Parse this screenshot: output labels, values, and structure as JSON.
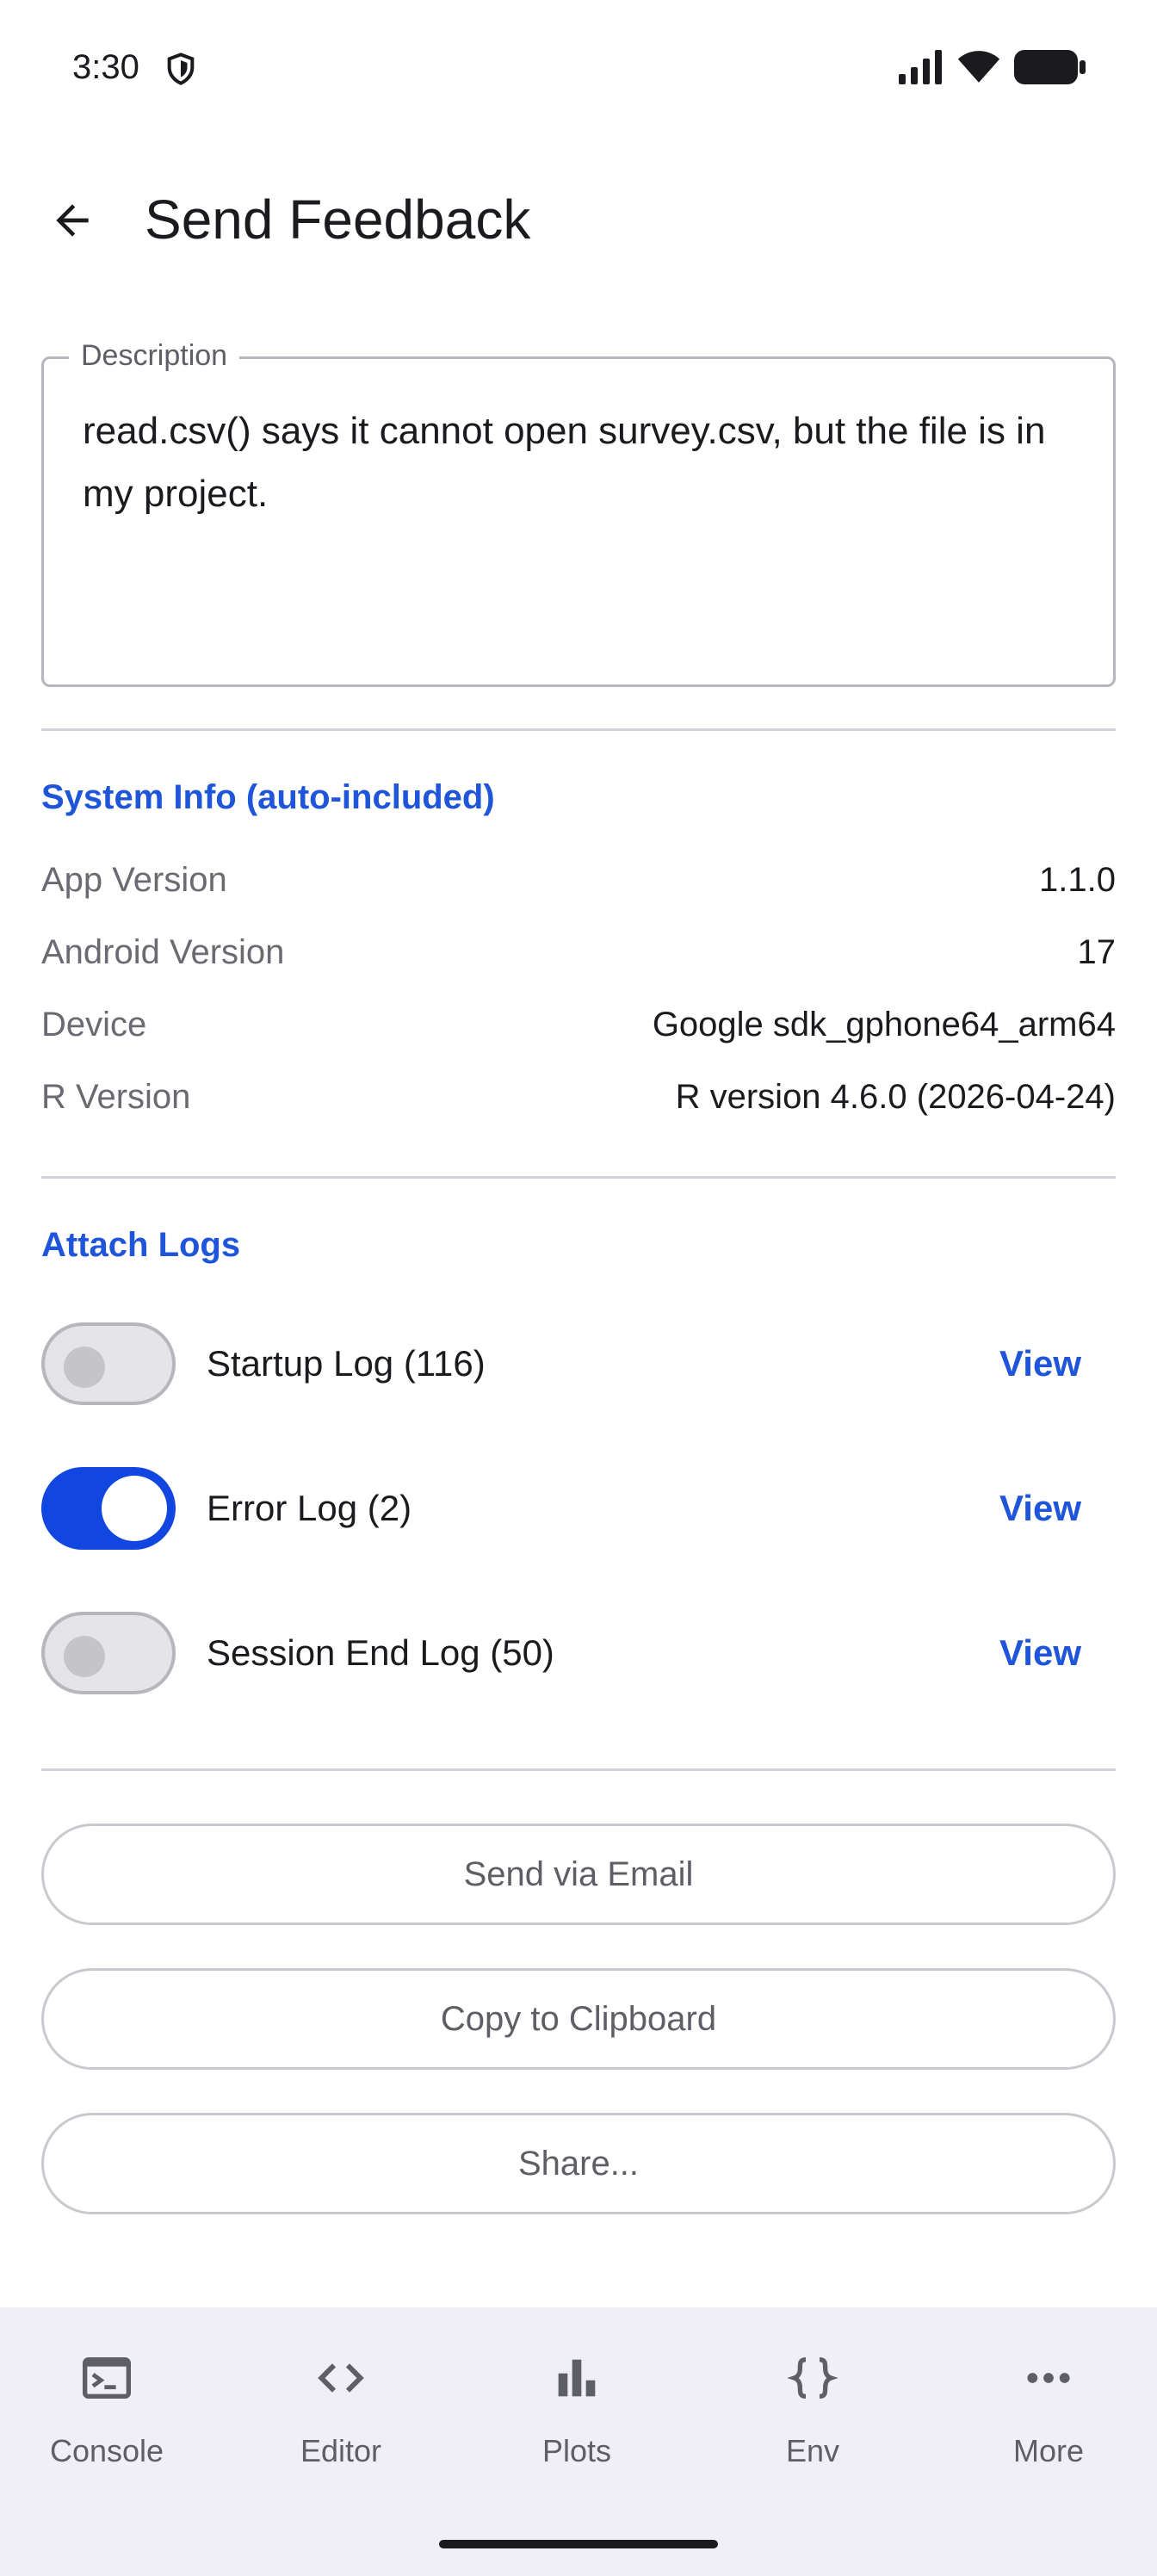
{
  "status_bar": {
    "time": "3:30"
  },
  "app_bar": {
    "title": "Send Feedback"
  },
  "description": {
    "label": "Description",
    "value": "read.csv() says it cannot open survey.csv, but the file is in my project."
  },
  "system_info": {
    "title": "System Info (auto-included)",
    "rows": [
      {
        "label": "App Version",
        "value": "1.1.0"
      },
      {
        "label": "Android Version",
        "value": "17"
      },
      {
        "label": "Device",
        "value": "Google sdk_gphone64_arm64"
      },
      {
        "label": "R Version",
        "value": "R version 4.6.0 (2026-04-24)"
      }
    ]
  },
  "attach_logs": {
    "title": "Attach Logs",
    "logs": [
      {
        "label": "Startup Log (116)",
        "enabled": false,
        "action": "View"
      },
      {
        "label": "Error Log (2)",
        "enabled": true,
        "action": "View"
      },
      {
        "label": "Session End Log (50)",
        "enabled": false,
        "action": "View"
      }
    ]
  },
  "actions": {
    "email": "Send via Email",
    "clipboard": "Copy to Clipboard",
    "share": "Share..."
  },
  "bottom_nav": {
    "items": [
      {
        "label": "Console",
        "icon": "terminal-icon"
      },
      {
        "label": "Editor",
        "icon": "code-icon"
      },
      {
        "label": "Plots",
        "icon": "bar-chart-icon"
      },
      {
        "label": "Env",
        "icon": "braces-icon"
      },
      {
        "label": "More",
        "icon": "more-horiz-icon"
      }
    ]
  },
  "colors": {
    "accent": "#1f55d9",
    "toggle_on": "#1246e0",
    "nav_bg": "#efeff5"
  }
}
